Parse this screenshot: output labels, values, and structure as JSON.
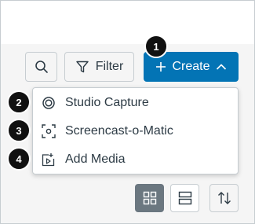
{
  "toolbar": {
    "search_icon": "search-icon",
    "filter_label": "Filter",
    "create_label": "Create"
  },
  "badges": [
    "1",
    "2",
    "3",
    "4"
  ],
  "menu": {
    "items": [
      {
        "label": "Studio Capture",
        "icon": "studio-capture-icon"
      },
      {
        "label": "Screencast-o-Matic",
        "icon": "screencast-icon"
      },
      {
        "label": "Add Media",
        "icon": "add-media-icon"
      }
    ]
  },
  "view_controls": {
    "grid_icon": "grid-view-icon",
    "list_icon": "list-view-icon",
    "sort_icon": "sort-icon"
  },
  "colors": {
    "accent": "#0374b5",
    "badge": "#111111",
    "border": "#c7cdd1",
    "text": "#2d3b45",
    "selected_view": "#6b7780"
  }
}
